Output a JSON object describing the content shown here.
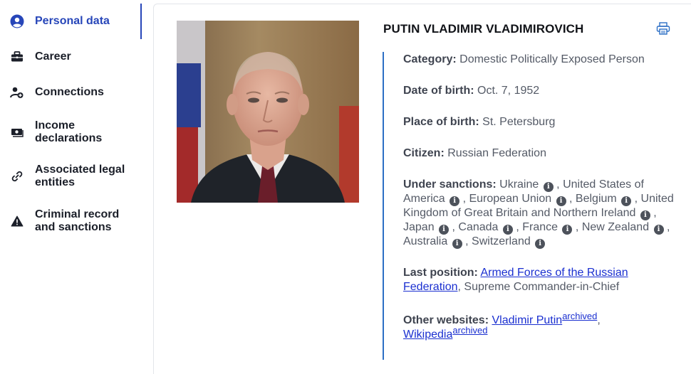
{
  "sidebar": {
    "items": [
      {
        "label": "Personal data",
        "icon": "user-circle-icon",
        "active": true
      },
      {
        "label": "Career",
        "icon": "briefcase-icon"
      },
      {
        "label": "Connections",
        "icon": "user-plus-icon"
      },
      {
        "label": "Income declarations",
        "icon": "money-icon"
      },
      {
        "label": "Associated legal entities",
        "icon": "link-icon"
      },
      {
        "label": "Criminal record and sanctions",
        "icon": "warning-icon"
      }
    ]
  },
  "profile": {
    "name": "PUTIN VLADIMIR VLADIMIROVICH",
    "category_label": "Category:",
    "category": "Domestic Politically Exposed Person",
    "dob_label": "Date of birth:",
    "dob": "Oct. 7, 1952",
    "pob_label": "Place of birth:",
    "pob": "St. Petersburg",
    "citizen_label": "Citizen:",
    "citizen": "Russian Federation",
    "sanctions_label": "Under sanctions:",
    "sanctions": [
      "Ukraine",
      "United States of America",
      "European Union",
      "Belgium",
      "United Kingdom of Great Britain and Northern Ireland",
      "Japan",
      "Canada",
      "France",
      "New Zealand",
      "Australia",
      "Switzerland"
    ],
    "last_position_label": "Last position:",
    "last_position_link": "Armed Forces of the Russian Federation",
    "last_position_rest": ", Supreme Commander-in-Chief",
    "websites_label": "Other websites:",
    "website1": "Vladimir Putin",
    "website2": "Wikipedia",
    "archived": "archived"
  },
  "colors": {
    "accent": "#2746b9",
    "timeline": "#2c6fc5",
    "link": "#1a2fd0"
  }
}
